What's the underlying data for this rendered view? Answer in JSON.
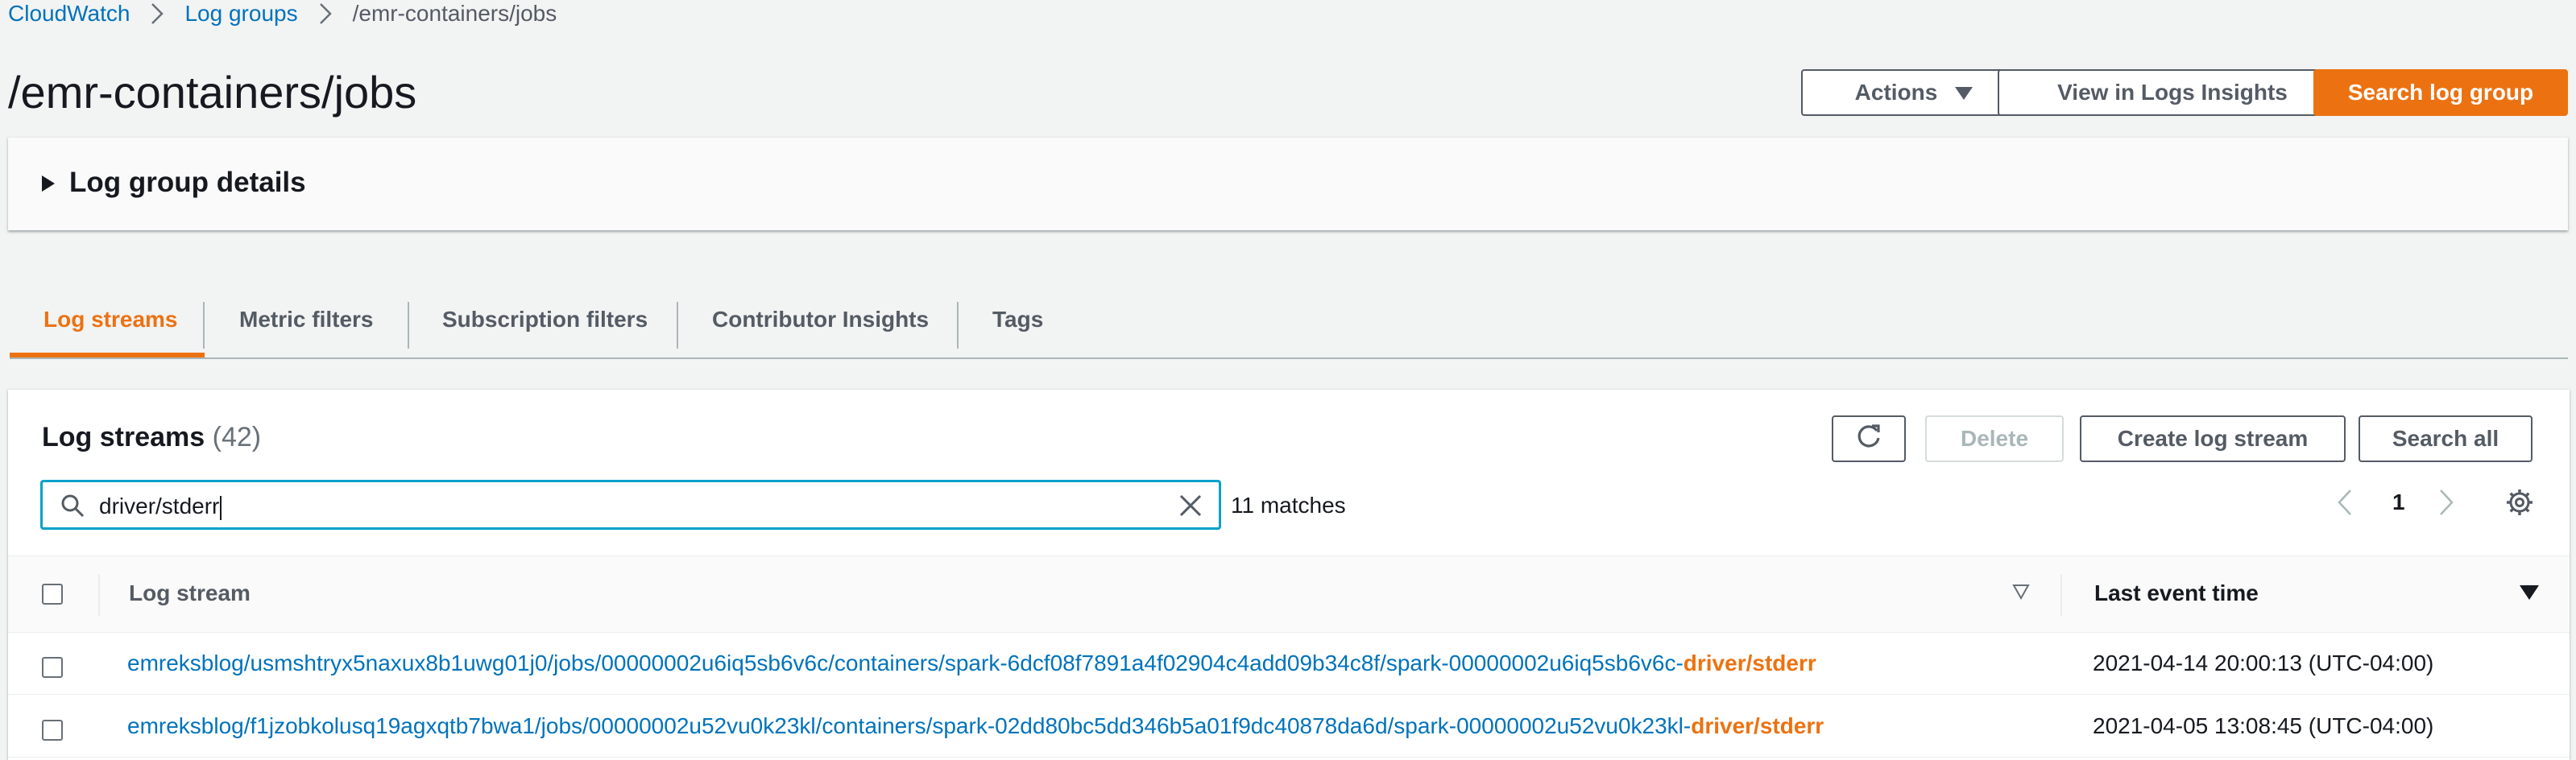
{
  "breadcrumb": {
    "items": [
      "CloudWatch",
      "Log groups"
    ],
    "current": "/emr-containers/jobs"
  },
  "page": {
    "title": "/emr-containers/jobs"
  },
  "header_buttons": {
    "actions": "Actions",
    "insights": "View in Logs Insights",
    "search": "Search log group"
  },
  "details": {
    "label": "Log group details"
  },
  "tabs": [
    "Log streams",
    "Metric filters",
    "Subscription filters",
    "Contributor Insights",
    "Tags"
  ],
  "streams_panel": {
    "title": "Log streams",
    "count": "(42)",
    "buttons": {
      "delete": "Delete",
      "create": "Create log stream",
      "search_all": "Search all"
    },
    "search_value": "driver/stderr",
    "matches": "11 matches",
    "page": "1",
    "columns": {
      "stream": "Log stream",
      "time": "Last event time"
    },
    "rows": [
      {
        "prefix": "emreksblog/usmshtryx5naxux8b1uwg01j0/jobs/00000002u6iq5sb6v6c/containers/spark-6dcf08f7891a4f02904c4add09b34c8f/spark-00000002u6iq5sb6v6c-",
        "highlight": "driver/stderr",
        "time": "2021-04-14 20:00:13 (UTC-04:00)"
      },
      {
        "prefix": "emreksblog/f1jzobkolusq19agxqtb7bwa1/jobs/00000002u52vu0k23kl/containers/spark-02dd80bc5dd346b5a01f9dc40878da6d/spark-00000002u52vu0k23kl-",
        "highlight": "driver/stderr",
        "time": "2021-04-05 13:08:45 (UTC-04:00)"
      }
    ]
  },
  "colors": {
    "accent": "#ec7211",
    "link": "#0073bb",
    "focus": "#00a1c9"
  }
}
